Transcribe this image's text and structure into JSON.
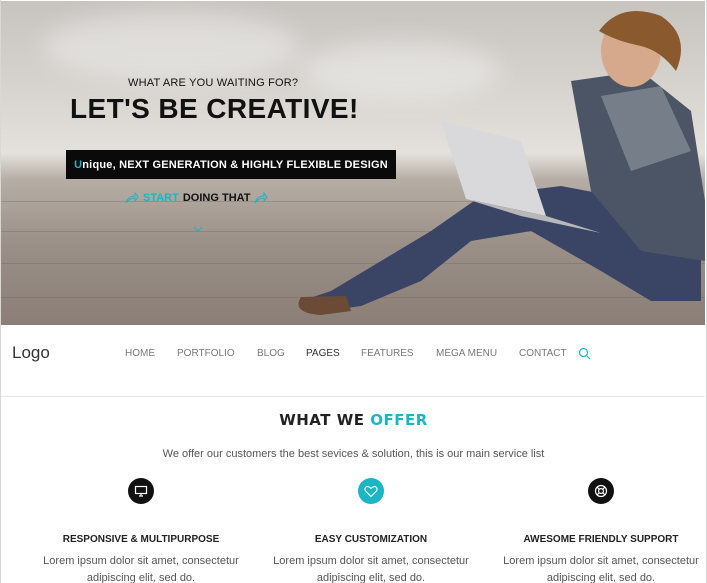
{
  "hero": {
    "subtitle": "WHAT ARE YOU WAITING FOR?",
    "title": "LET'S BE CREATIVE!",
    "badge_first_letter": "U",
    "badge_rest": "nique, NEXT GENERATION & HIGHLY FLEXIBLE DESIGN",
    "cta_accent": "START",
    "cta_rest": "DOING THAT",
    "scroll_icon": "chevron-down-icon"
  },
  "nav": {
    "logo": "Logo",
    "items": [
      "HOME",
      "PORTFOLIO",
      "BLOG",
      "PAGES",
      "FEATURES",
      "MEGA MENU",
      "CONTACT"
    ],
    "active": "PAGES",
    "search_icon": "search-icon"
  },
  "offer": {
    "title_part1": "WHAT WE",
    "title_part2": "OFFER",
    "subtitle": "We offer our customers the best sevices & solution, this is our main service list",
    "services": [
      {
        "icon": "monitor-icon",
        "icon_color": "#111111",
        "title": "RESPONSIVE & MULTIPURPOSE",
        "text": "Lorem ipsum dolor sit amet, consectetur adipiscing elit, sed do."
      },
      {
        "icon": "heart-icon",
        "icon_color": "#1cb5c5",
        "title": "EASY CUSTOMIZATION",
        "text": "Lorem ipsum dolor sit amet, consectetur adipiscing elit, sed do."
      },
      {
        "icon": "lifebuoy-icon",
        "icon_color": "#111111",
        "title": "AWESOME FRIENDLY SUPPORT",
        "text": "Lorem ipsum dolor sit amet, consectetur adipiscing elit, sed do."
      }
    ]
  },
  "colors": {
    "accent": "#1cb5c5",
    "dark": "#0a0a0a"
  }
}
